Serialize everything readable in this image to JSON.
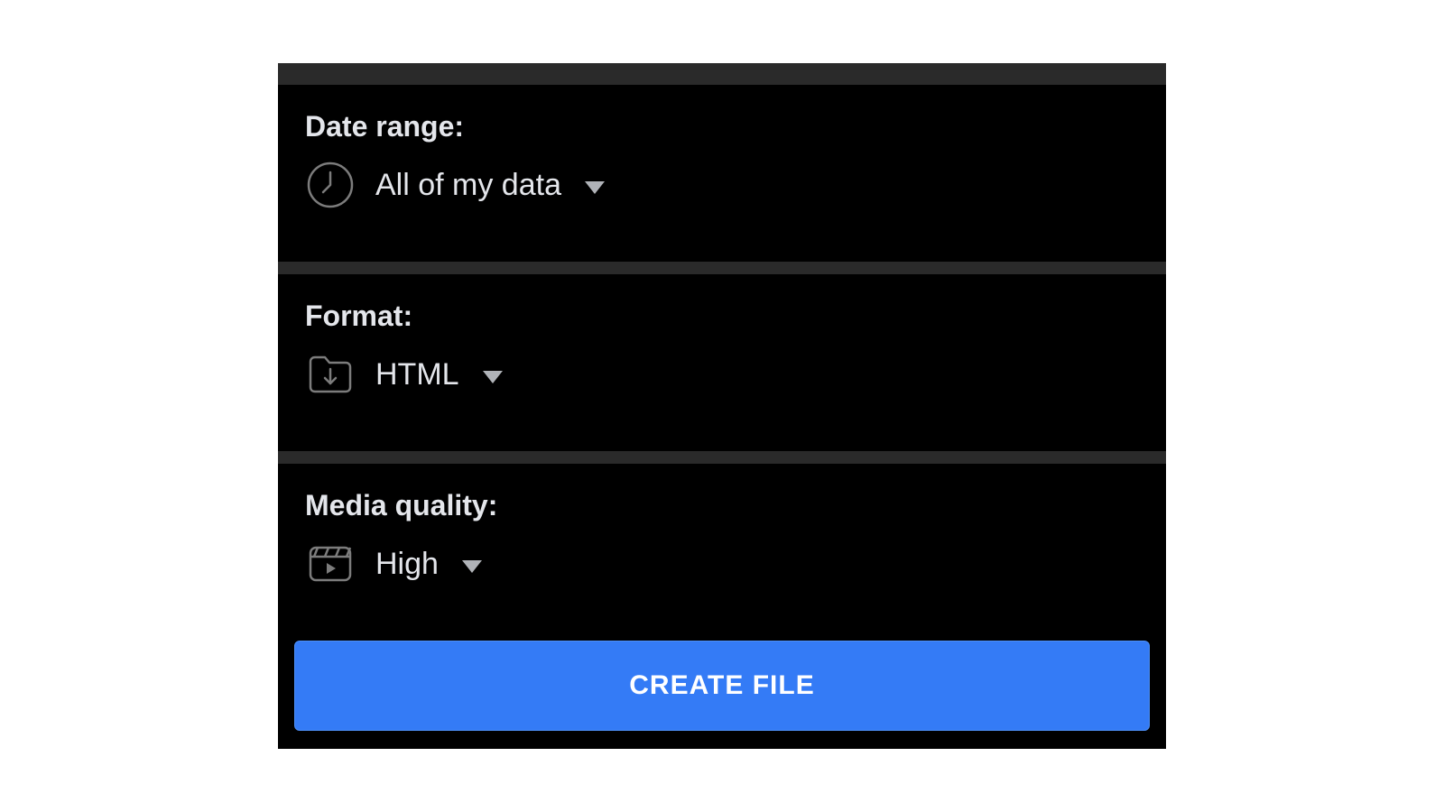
{
  "settings": {
    "dateRange": {
      "label": "Date range:",
      "value": "All of my data"
    },
    "format": {
      "label": "Format:",
      "value": "HTML"
    },
    "mediaQuality": {
      "label": "Media quality:",
      "value": "High"
    }
  },
  "actions": {
    "createFile": "CREATE FILE"
  },
  "colors": {
    "primary": "#347bf6",
    "panelBg": "#000000",
    "separator": "#2a2a2a",
    "text": "#e4e6eb",
    "iconStroke": "#7c7c7c"
  }
}
